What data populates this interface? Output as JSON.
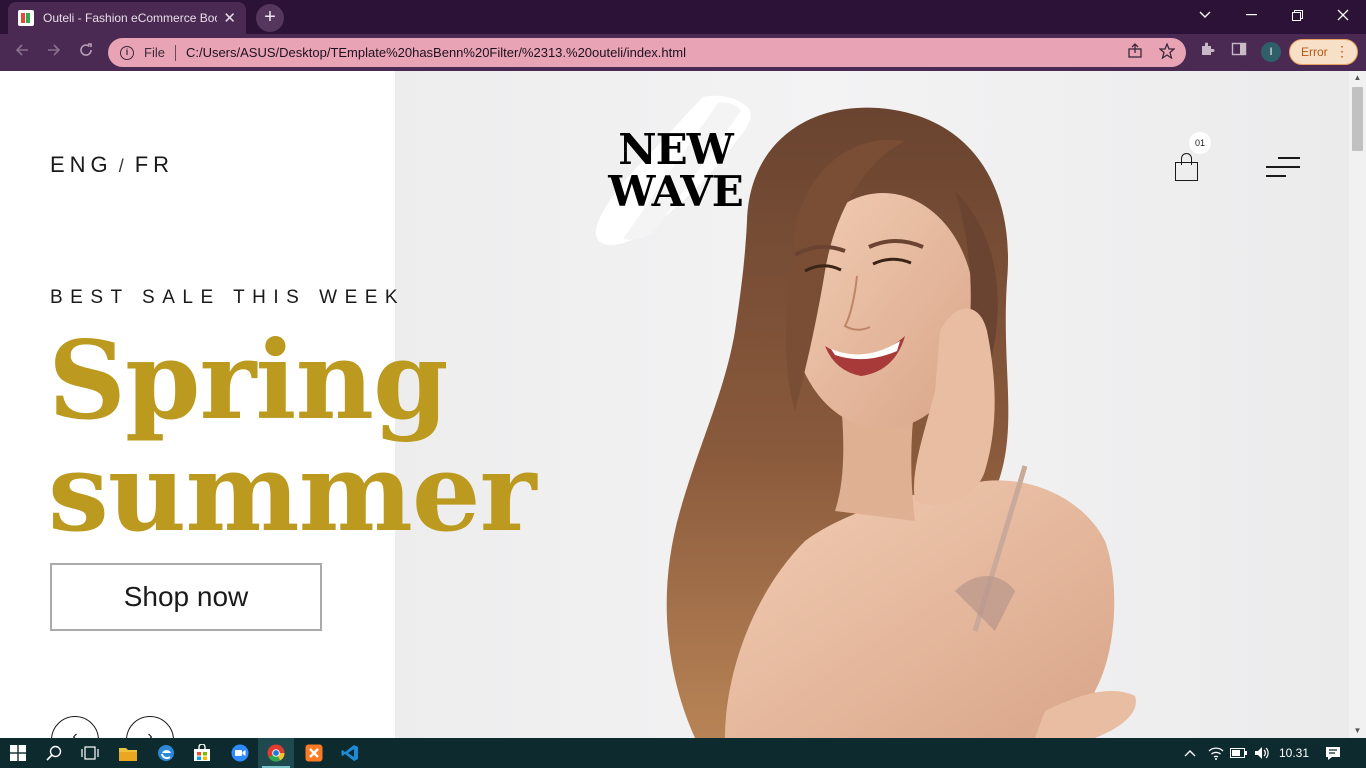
{
  "browser": {
    "tab_title": "Outeli - Fashion eCommerce Boo",
    "tab_close": "✕",
    "new_tab": "+",
    "scheme_label": "File",
    "url": "C:/Users/ASUS/Desktop/TEmplate%20hasBenn%20Filter/%2313.%20outeli/index.html",
    "error_label": "Error",
    "profile_initial": "I"
  },
  "site": {
    "lang_primary": "ENG",
    "lang_separator": "/",
    "lang_secondary": "FR",
    "logo_line1": "NEW",
    "logo_line2": "WAVE",
    "cart_count": "01",
    "hero": {
      "kicker": "BEST SALE THIS WEEK",
      "headline_line1": "Spring",
      "headline_line2": "summer",
      "cta_label": "Shop now",
      "accent_color": "#bc9a1f"
    }
  },
  "taskbar": {
    "clock": "10.31",
    "apps": [
      "start-icon",
      "search-icon",
      "task-view-icon",
      "file-explorer-icon",
      "edge-icon",
      "store-icon",
      "zoom-icon",
      "chrome-icon",
      "xampp-icon",
      "vscode-icon"
    ]
  }
}
